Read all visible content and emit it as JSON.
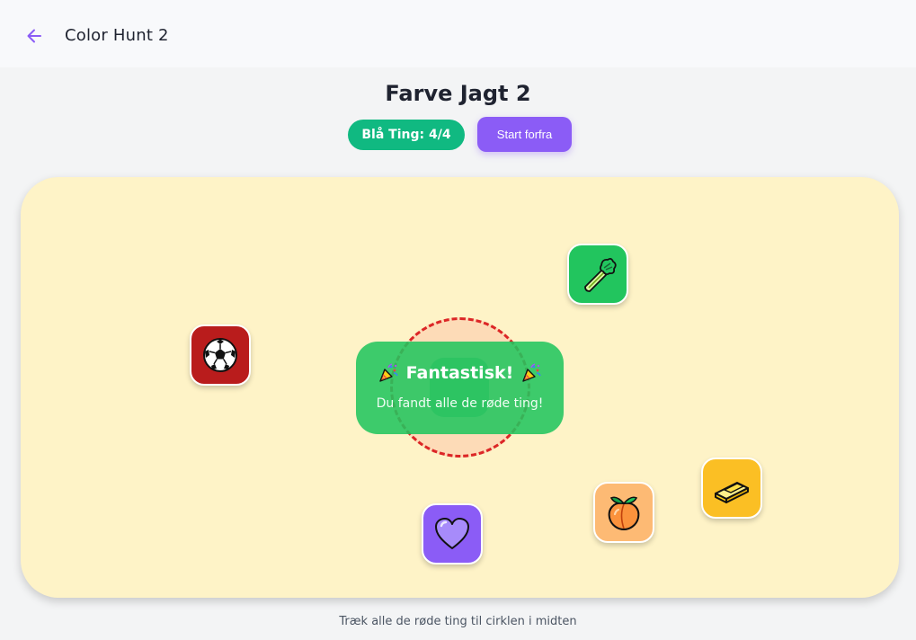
{
  "header": {
    "back_icon": "arrow-left-icon",
    "title": "Color Hunt 2"
  },
  "game": {
    "title": "Farve Jagt 2",
    "score_label": "Blå Ting: 4/4",
    "found": 4,
    "total": 4,
    "restart_label": "Start forfra"
  },
  "board": {
    "items": [
      {
        "name": "soccer-ball-icon",
        "tile_color": "#b91c1c"
      },
      {
        "name": "celery-icon",
        "tile_color": "#22c55e"
      },
      {
        "name": "purple-heart-icon",
        "tile_color": "#8b5cf6"
      },
      {
        "name": "peach-icon",
        "tile_color": "#fdba74"
      },
      {
        "name": "butter-icon",
        "tile_color": "#fbbf24"
      }
    ]
  },
  "success": {
    "title": "Fantastisk!",
    "message": "Du fandt alle de røde ting!",
    "icon": "party-popper-icon"
  },
  "instructions": "Træk alle de røde ting til cirklen i midten",
  "colors": {
    "accent": "#8b5cf6",
    "score_green": "#10b981",
    "board_bg": "#fef3c7",
    "target_red": "#dc2626",
    "success_green": "#22c55e"
  }
}
